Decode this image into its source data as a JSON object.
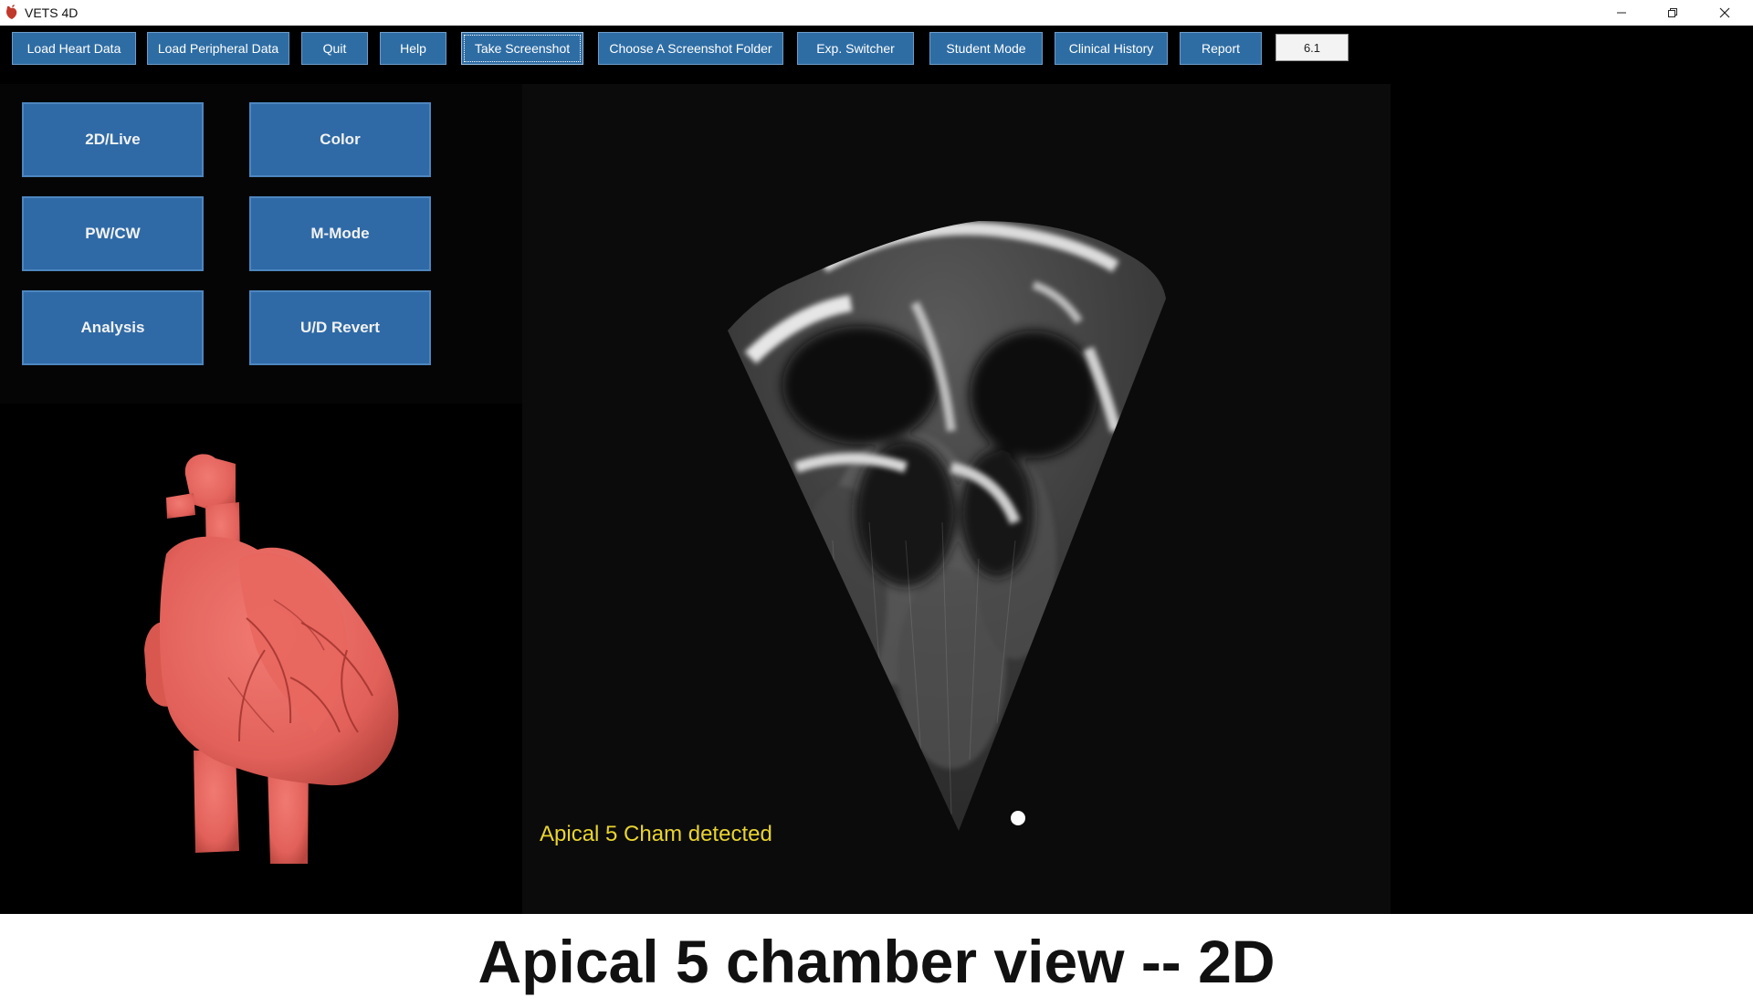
{
  "window": {
    "title": "VETS 4D",
    "controls": {
      "minimize": "minimize-icon",
      "maximize": "restore-icon",
      "close": "close-icon"
    }
  },
  "toolbar": {
    "buttons": [
      {
        "label": "Load Heart Data"
      },
      {
        "label": "Load Peripheral Data"
      },
      {
        "label": "Quit"
      },
      {
        "label": "Help"
      },
      {
        "label": "Take Screenshot",
        "focused": true
      },
      {
        "label": "Choose A Screenshot Folder"
      },
      {
        "label": "Exp. Switcher"
      },
      {
        "label": "Student Mode"
      },
      {
        "label": "Clinical History"
      },
      {
        "label": "Report"
      }
    ],
    "version_value": "6.1"
  },
  "mode_panel": {
    "buttons": [
      {
        "label": "2D/Live"
      },
      {
        "label": "Color"
      },
      {
        "label": "PW/CW"
      },
      {
        "label": "M-Mode"
      },
      {
        "label": "Analysis"
      },
      {
        "label": "U/D Revert"
      }
    ]
  },
  "heart_view": {
    "model": "3d-heart-model",
    "color": "#e2615a"
  },
  "ultrasound_view": {
    "status_text": "Apical 5 Cham detected",
    "status_color": "#e9d42e"
  },
  "caption": {
    "text": "Apical 5 chamber view -- 2D"
  },
  "colors": {
    "button_blue": "#2f6aa6",
    "background": "#000000"
  }
}
